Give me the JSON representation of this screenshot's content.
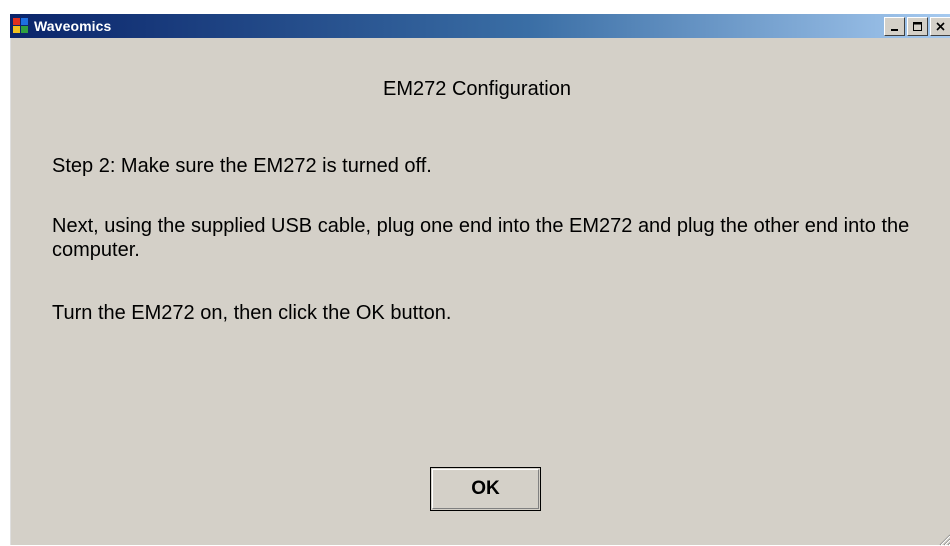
{
  "window": {
    "title": "Waveomics",
    "icon": "application-icon",
    "controls": [
      "minimize-icon",
      "maximize-icon",
      "close-icon"
    ]
  },
  "dialog": {
    "heading": "EM272 Configuration",
    "step_text": "Step 2: Make sure the EM272 is turned off.",
    "next_text": "Next, using the supplied USB cable, plug one end into the EM272 and plug the other end into the computer.",
    "turn_on_text": "Turn the EM272 on, then click the OK button.",
    "ok_label": "OK"
  },
  "colors": {
    "titlebar_start": "#0a246a",
    "titlebar_end": "#a6caf0",
    "dialog_background": "#d4d0c8"
  }
}
